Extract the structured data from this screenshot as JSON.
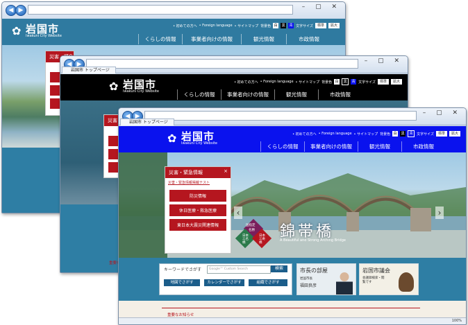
{
  "browser": {
    "tab_title": "岩国市 トップページ",
    "zoom": "100%"
  },
  "site": {
    "logo_name": "岩国市",
    "logo_sub": "Iwakuni City Website",
    "util": {
      "first_time": "• 初めての方へ",
      "foreign": "• Foreign language",
      "sitemap": "• サイトマップ",
      "bgcolor_label": "背景色",
      "bg_white": "白",
      "bg_black": "黒",
      "bg_blue": "青",
      "fontsize_label": "文字サイズ",
      "standard": "標準",
      "enlarge": "拡大"
    },
    "gnav": [
      "くらしの情報",
      "事業者向けの情報",
      "観光情報",
      "市政情報"
    ],
    "alert": {
      "title": "災害・緊急情報",
      "close": "×",
      "test_link": "災害・緊急情報掲載テスト",
      "buttons": [
        "防災情報",
        "休日医療・救急医療",
        "東日本大震災関連情報"
      ]
    },
    "hero": {
      "caption_title": "錦帯橋",
      "caption_sub": "A Beautiful and Strong Arching Bridge",
      "badge_center_top": "国指定",
      "badge_center_bottom": "名勝",
      "badge_left": "日本三名橋",
      "badge_right": "日本三奇橋",
      "prev": "‹",
      "next": "›"
    },
    "search": {
      "label": "キーワードでさがす",
      "placeholder": "Google™ Custom Search",
      "go": "検索",
      "buttons": [
        "地図でさがす",
        "カレンダーでさがす",
        "組織でさがす"
      ]
    },
    "banners": {
      "mayor_title": "市長の部屋",
      "mayor_sub": "岩国市長",
      "mayor_name": "福田良彦",
      "council_title": "岩国市議会",
      "council_sub": "会議録検索・閲覧です"
    },
    "notice": "重要なお知らせ"
  },
  "colors": {
    "head_black": "#000000",
    "head_blue": "#0a12ee",
    "site_teal": "#2f7aa0",
    "alert_red": "#b5161f"
  }
}
